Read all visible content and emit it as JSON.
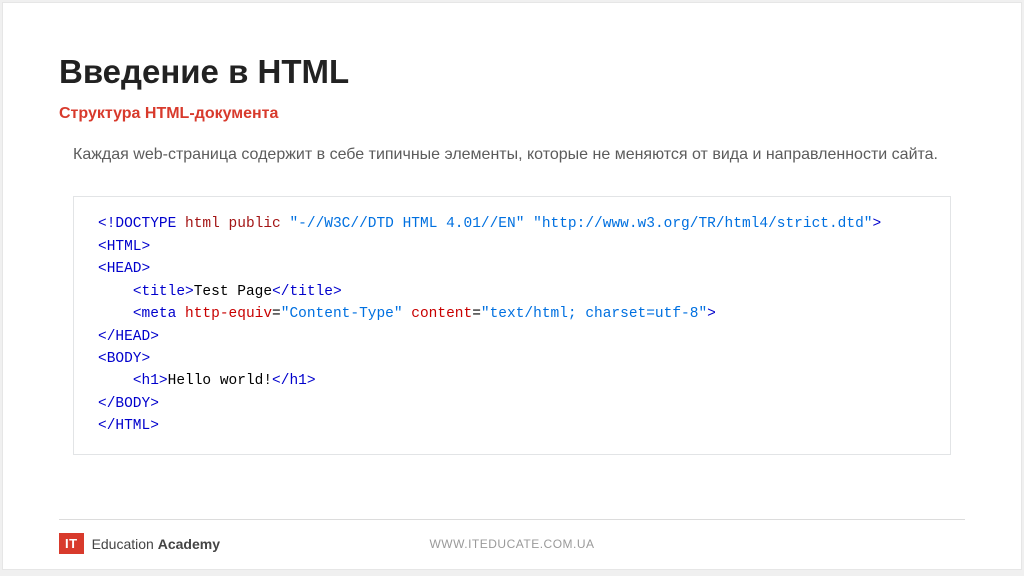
{
  "title": "Введение в HTML",
  "subtitle": "Структура HTML-документа",
  "description": "Каждая web-страница содержит в себе типичные элементы, которые не меняются от вида и направленности сайта.",
  "code": {
    "doctype_kw": "<!DOCTYPE",
    "doctype_html": "html",
    "doctype_public": "public",
    "doctype_str1": "\"-//W3C//DTD HTML 4.01//EN\"",
    "doctype_str2": "\"http://www.w3.org/TR/html4/strict.dtd\"",
    "html_open": "<HTML>",
    "head_open": "<HEAD>",
    "title_open": "<title>",
    "title_text": "Test Page",
    "title_close": "</title>",
    "meta_open": "<meta",
    "meta_attr1_name": "http-equiv",
    "meta_attr1_val": "\"Content-Type\"",
    "meta_attr2_name": "content",
    "meta_attr2_val": "\"text/html; charset=utf-8\"",
    "head_close": "</HEAD>",
    "body_open": "<BODY>",
    "h1_open": "<h1>",
    "h1_text": "Hello world!",
    "h1_close": "</h1>",
    "body_close": "</BODY>",
    "html_close": "</HTML>"
  },
  "footer": {
    "logo_badge": "IT",
    "logo_text_light": "Education ",
    "logo_text_bold": "Academy",
    "url": "WWW.ITEDUCATE.COM.UA"
  }
}
